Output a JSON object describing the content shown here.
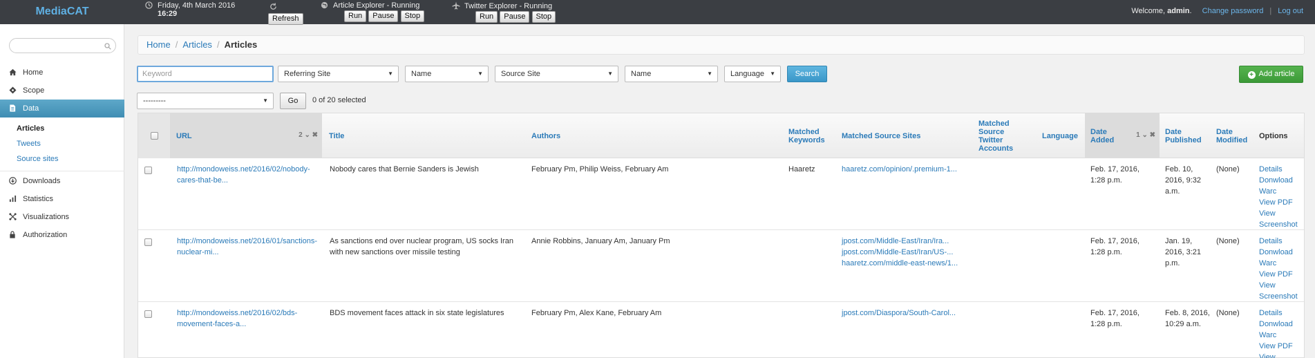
{
  "topbar": {
    "brand": "MediaCAT",
    "date": "Friday, 4th March 2016",
    "time": "16:29",
    "refresh_label": "Refresh",
    "article_explorer": "Article Explorer - Running",
    "twitter_explorer": "Twitter Explorer - Running",
    "run_label": "Run",
    "pause_label": "Pause",
    "stop_label": "Stop",
    "welcome_prefix": "Welcome,",
    "username": "admin",
    "change_password": "Change password",
    "logout": "Log out"
  },
  "sidebar": {
    "search_placeholder": "",
    "items": [
      {
        "label": "Home",
        "icon": "home-icon"
      },
      {
        "label": "Scope",
        "icon": "crosshair-icon"
      },
      {
        "label": "Data",
        "icon": "document-icon",
        "active": true
      },
      {
        "label": "Downloads",
        "icon": "download-icon"
      },
      {
        "label": "Statistics",
        "icon": "bar-chart-icon"
      },
      {
        "label": "Visualizations",
        "icon": "network-icon"
      },
      {
        "label": "Authorization",
        "icon": "lock-icon"
      }
    ],
    "subitems": [
      "Articles",
      "Tweets",
      "Source sites"
    ]
  },
  "breadcrumb": [
    "Home",
    "Articles",
    "Articles"
  ],
  "filters": {
    "keyword_placeholder": "Keyword",
    "referring_site": "Referring Site",
    "name1": "Name",
    "source_site": "Source Site",
    "name2": "Name",
    "language": "Language",
    "search_label": "Search",
    "add_article_label": "Add article",
    "action_select": "---------",
    "go_label": "Go",
    "selected_count": "0 of 20 selected"
  },
  "table": {
    "headers": {
      "url": "URL",
      "url_sort": "2",
      "title": "Title",
      "authors": "Authors",
      "matched_keywords": "Matched Keywords",
      "matched_source_sites": "Matched Source Sites",
      "matched_twitter": "Matched Source Twitter Accounts",
      "language": "Language",
      "date_added": "Date Added",
      "date_added_sort": "1",
      "date_published": "Date Published",
      "date_modified": "Date Modified",
      "options": "Options"
    },
    "actions": [
      "Details",
      "Donwload",
      "Warc",
      "View PDF",
      "View Screenshot"
    ],
    "rows": [
      {
        "url": "http://mondoweiss.net/2016/02/nobody-cares-that-be...",
        "title": "Nobody cares that Bernie Sanders is Jewish",
        "authors": "February Pm, Philip Weiss, February Am",
        "keywords": "Haaretz",
        "sources": [
          "haaretz.com/opinion/.premium-1..."
        ],
        "date_added": "Feb. 17, 2016, 1:28 p.m.",
        "date_published": "Feb. 10, 2016, 9:32 a.m.",
        "date_modified": "(None)"
      },
      {
        "url": "http://mondoweiss.net/2016/01/sanctions-nuclear-mi...",
        "title": "As sanctions end over nuclear program, US socks Iran with new sanctions over missile testing",
        "authors": "Annie Robbins, January Am, January Pm",
        "keywords": "",
        "sources": [
          "jpost.com/Middle-East/Iran/Ira...",
          "jpost.com/Middle-East/Iran/US-...",
          "haaretz.com/middle-east-news/1..."
        ],
        "date_added": "Feb. 17, 2016, 1:28 p.m.",
        "date_published": "Jan. 19, 2016, 3:21 p.m.",
        "date_modified": "(None)"
      },
      {
        "url": "http://mondoweiss.net/2016/02/bds-movement-faces-a...",
        "title": "BDS movement faces attack in six state legislatures",
        "authors": "February Pm, Alex Kane, February Am",
        "keywords": "",
        "sources": [
          "jpost.com/Diaspora/South-Carol..."
        ],
        "date_added": "Feb. 17, 2016, 1:28 p.m.",
        "date_published": "Feb. 8, 2016, 10:29 a.m.",
        "date_modified": "(None)"
      }
    ]
  }
}
